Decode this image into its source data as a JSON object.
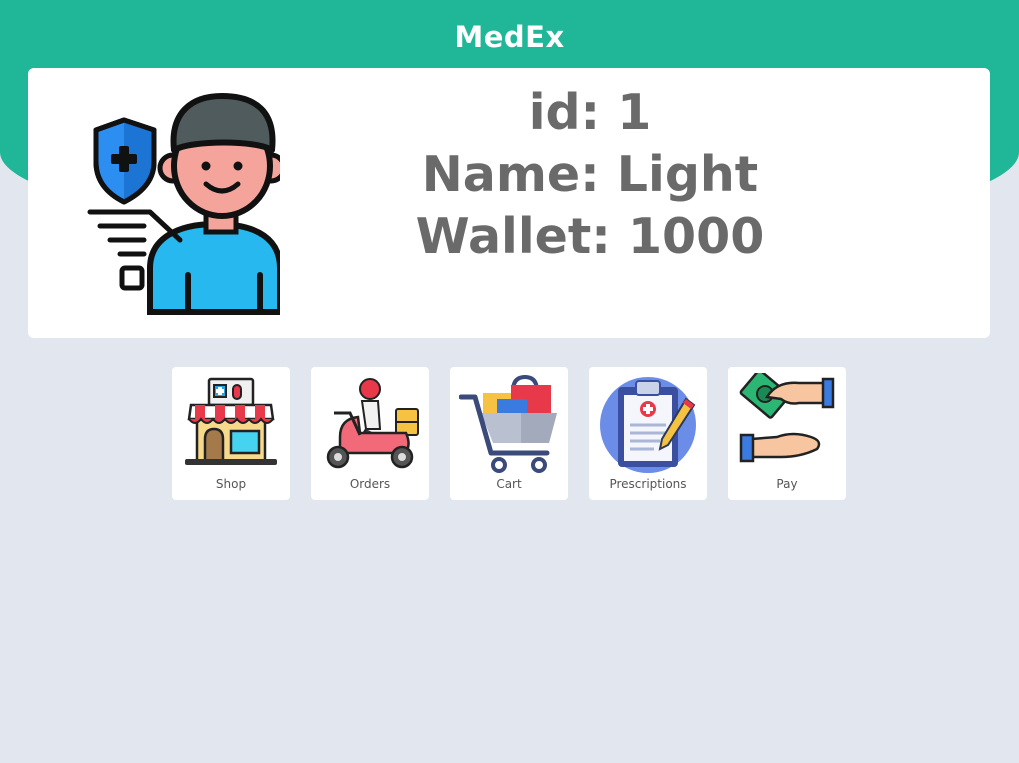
{
  "app": {
    "title": "MedEx"
  },
  "profile": {
    "id_text": "id: 1",
    "name_text": "Name: Light",
    "wallet_text": "Wallet: 1000",
    "avatar_icon": "patient-avatar-icon"
  },
  "menu": {
    "items": [
      {
        "label": "Shop",
        "icon": "pharmacy-shop-icon"
      },
      {
        "label": "Orders",
        "icon": "delivery-scooter-icon"
      },
      {
        "label": "Cart",
        "icon": "shopping-cart-icon"
      },
      {
        "label": "Prescriptions",
        "icon": "prescription-clipboard-icon"
      },
      {
        "label": "Pay",
        "icon": "payment-hands-icon"
      }
    ]
  },
  "colors": {
    "brand": "#20b698",
    "background": "#e2e7ef",
    "card": "#ffffff",
    "profile_text": "#6a6a6a"
  }
}
